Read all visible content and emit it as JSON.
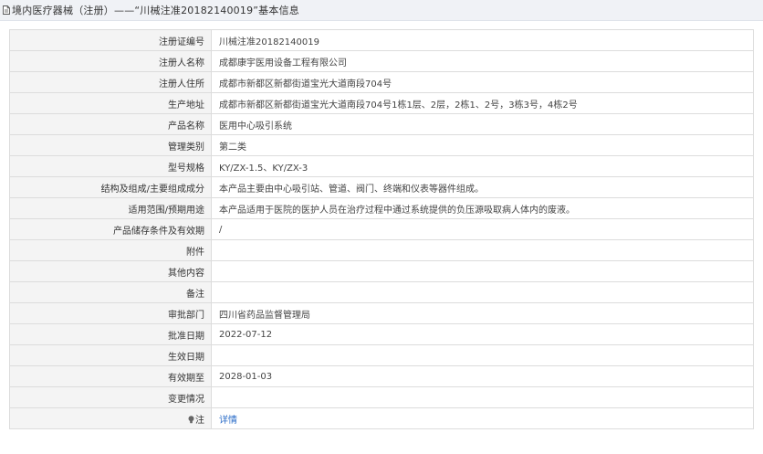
{
  "header": {
    "icon": "document-icon",
    "title": "境内医疗器械（注册）——“川械注准20182140019”基本信息"
  },
  "rows": [
    {
      "label": "注册证编号",
      "value": "川械注准20182140019"
    },
    {
      "label": "注册人名称",
      "value": "成都康宇医用设备工程有限公司"
    },
    {
      "label": "注册人住所",
      "value": "成都市新都区新都街道宝光大道南段704号"
    },
    {
      "label": "生产地址",
      "value": "成都市新都区新都街道宝光大道南段704号1栋1层、2层，2栋1、2号，3栋3号，4栋2号"
    },
    {
      "label": "产品名称",
      "value": "医用中心吸引系统"
    },
    {
      "label": "管理类别",
      "value": "第二类"
    },
    {
      "label": "型号规格",
      "value": "KY/ZX-1.5、KY/ZX-3"
    },
    {
      "label": "结构及组成/主要组成成分",
      "value": "本产品主要由中心吸引站、管道、阀门、终端和仪表等器件组成。"
    },
    {
      "label": "适用范围/预期用途",
      "value": "本产品适用于医院的医护人员在治疗过程中通过系统提供的负压源吸取病人体内的废液。"
    },
    {
      "label": "产品储存条件及有效期",
      "value": "/"
    },
    {
      "label": "附件",
      "value": ""
    },
    {
      "label": "其他内容",
      "value": ""
    },
    {
      "label": "备注",
      "value": ""
    },
    {
      "label": "审批部门",
      "value": "四川省药品监督管理局"
    },
    {
      "label": "批准日期",
      "value": "2022-07-12"
    },
    {
      "label": "生效日期",
      "value": ""
    },
    {
      "label": "有效期至",
      "value": "2028-01-03"
    },
    {
      "label": "变更情况",
      "value": ""
    }
  ],
  "note_row": {
    "icon": "lightbulb-icon",
    "label": "注",
    "link": "详情"
  },
  "colors": {
    "header_bg": "#f0f2f6",
    "label_bg": "#f4f4f4",
    "border": "#dcdcdc",
    "link": "#2a6cc8"
  }
}
